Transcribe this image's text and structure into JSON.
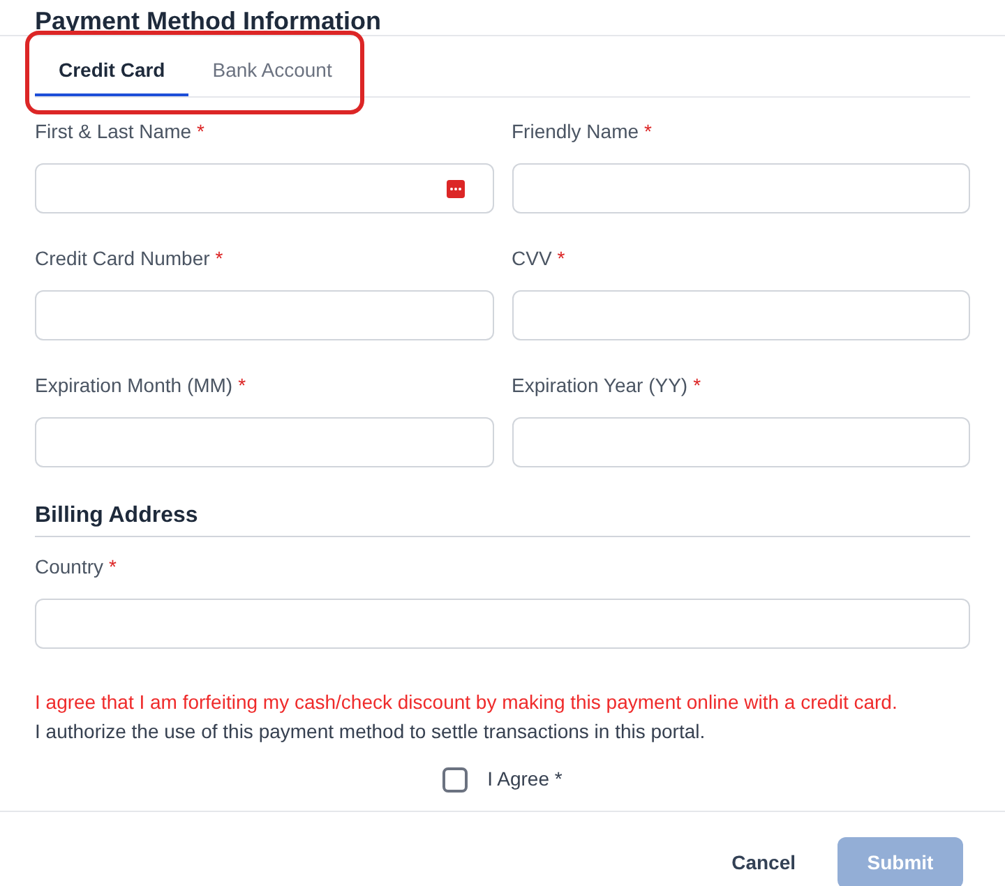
{
  "title": "Payment Method Information",
  "tabs_highlighted": true,
  "tabs": [
    {
      "label": "Credit Card",
      "selected": true
    },
    {
      "label": "Bank Account",
      "selected": false
    }
  ],
  "fields": [
    {
      "label": "First & Last Name",
      "required": "*",
      "autofill_icon": true
    },
    {
      "label": "Friendly Name",
      "required": "*",
      "autofill_icon": false
    },
    {
      "label": "Credit Card Number",
      "required": "*",
      "autofill_icon": false
    },
    {
      "label": "CVV",
      "required": "*",
      "autofill_icon": false
    },
    {
      "label": "Expiration Month (MM)",
      "required": "*",
      "autofill_icon": false
    },
    {
      "label": "Expiration Year (YY)",
      "required": "*",
      "autofill_icon": false
    }
  ],
  "billing": {
    "heading": "Billing Address",
    "country": {
      "label": "Country",
      "required": "*"
    }
  },
  "notice": "I agree that I am forfeiting my cash/check discount by making this payment online with a credit card.",
  "authorization": "I authorize the use of this payment method to settle transactions in this portal.",
  "agree": {
    "label": "I Agree *",
    "checked": false
  },
  "buttons": {
    "cancel": "Cancel",
    "submit": {
      "label": "Submit",
      "disabled": true
    }
  }
}
